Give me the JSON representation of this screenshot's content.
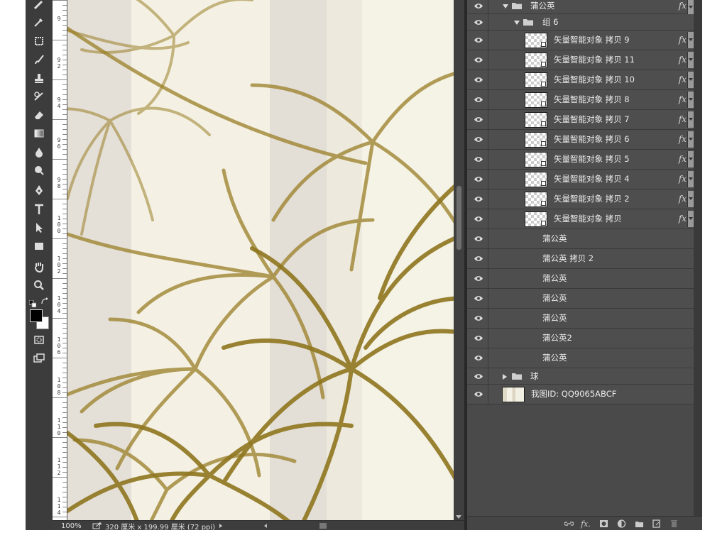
{
  "status": {
    "zoom": "100%",
    "doc_info": "320 厘米 x 199.99 厘米 (72 ppi)"
  },
  "ruler": {
    "labels": [
      "9",
      "9 2",
      "9 4",
      "9 6",
      "9 8",
      "1 0 0",
      "1 0 2",
      "1 0 4",
      "1 0 6",
      "1 0 8",
      "1 1 0",
      "1 1 2",
      "1 1 4"
    ]
  },
  "layers": {
    "group_top": {
      "name": "蒲公英",
      "fx": "fx"
    },
    "group_sub": {
      "name": "组 6"
    },
    "smart_objects": [
      {
        "name": "矢量智能对象 拷贝 9",
        "fx": "fx"
      },
      {
        "name": "矢量智能对象 拷贝 11",
        "fx": "fx"
      },
      {
        "name": "矢量智能对象 拷贝 10",
        "fx": "fx"
      },
      {
        "name": "矢量智能对象 拷贝 8",
        "fx": "fx"
      },
      {
        "name": "矢量智能对象 拷贝 7",
        "fx": "fx"
      },
      {
        "name": "矢量智能对象 拷贝 6",
        "fx": "fx"
      },
      {
        "name": "矢量智能对象 拷贝 5",
        "fx": "fx"
      },
      {
        "name": "矢量智能对象 拷贝 4",
        "fx": "fx"
      },
      {
        "name": "矢量智能对象 拷贝 2",
        "fx": "fx"
      },
      {
        "name": "矢量智能对象 拷贝",
        "fx": "fx"
      }
    ],
    "plain": [
      {
        "name": "蒲公英"
      },
      {
        "name": "蒲公英 拷贝 2"
      },
      {
        "name": "蒲公英"
      },
      {
        "name": "蒲公英"
      },
      {
        "name": "蒲公英"
      },
      {
        "name": "蒲公英2"
      },
      {
        "name": "蒲公英"
      }
    ],
    "group_ball": {
      "name": "球"
    },
    "background": {
      "name": "我图ID: QQ9065ABCF"
    }
  },
  "footer": {
    "fx_label": "fx."
  },
  "colors": {
    "ui_bg": "#535353",
    "panel_row": "#4e4e4e",
    "canvas_cream": "#f2ede0",
    "stroke_gold": "#9a7f27"
  }
}
